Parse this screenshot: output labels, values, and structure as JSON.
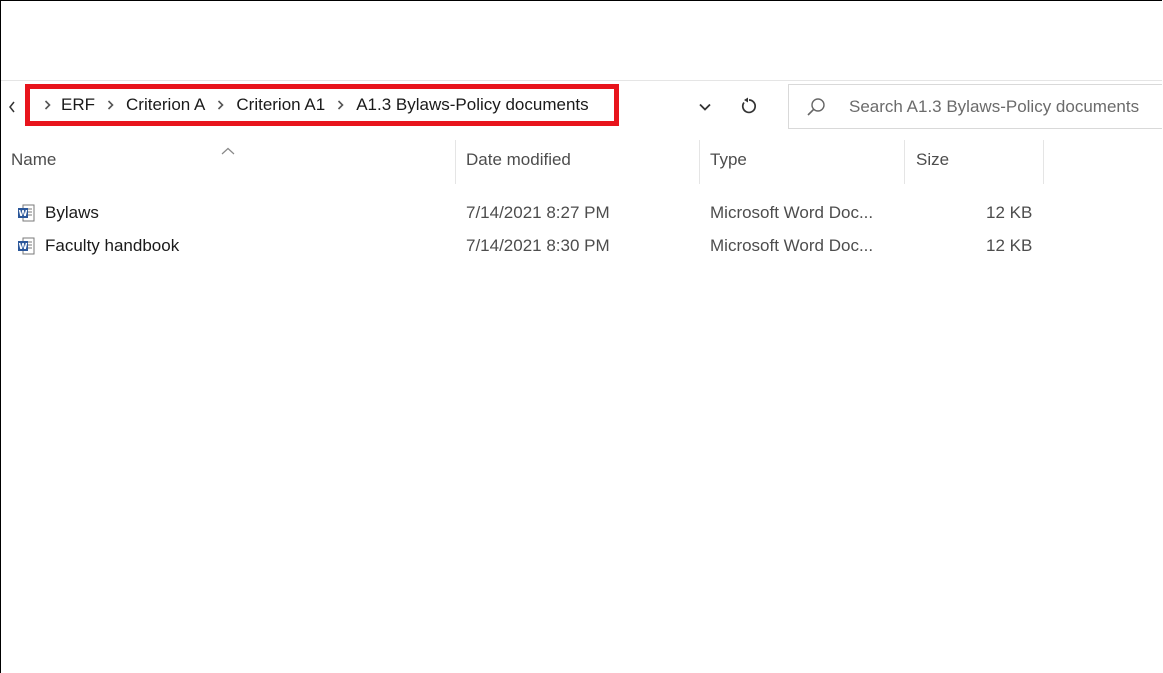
{
  "address_bar": {
    "overflow_glyph": "«",
    "breadcrumbs": [
      "ERF",
      "Criterion A",
      "Criterion A1",
      "A1.3 Bylaws-Policy documents"
    ],
    "separator": ">"
  },
  "search": {
    "placeholder": "Search A1.3 Bylaws-Policy documents"
  },
  "columns": {
    "name": "Name",
    "date_modified": "Date modified",
    "type": "Type",
    "size": "Size"
  },
  "files": [
    {
      "name": "Bylaws",
      "date_modified": "7/14/2021 8:27 PM",
      "type": "Microsoft Word Doc...",
      "size": "12 KB",
      "icon": "word-document-icon"
    },
    {
      "name": "Faculty handbook",
      "date_modified": "7/14/2021 8:30 PM",
      "type": "Microsoft Word Doc...",
      "size": "12 KB",
      "icon": "word-document-icon"
    }
  ],
  "colors": {
    "highlight_border": "#e8141c",
    "word_blue": "#2b579a"
  }
}
